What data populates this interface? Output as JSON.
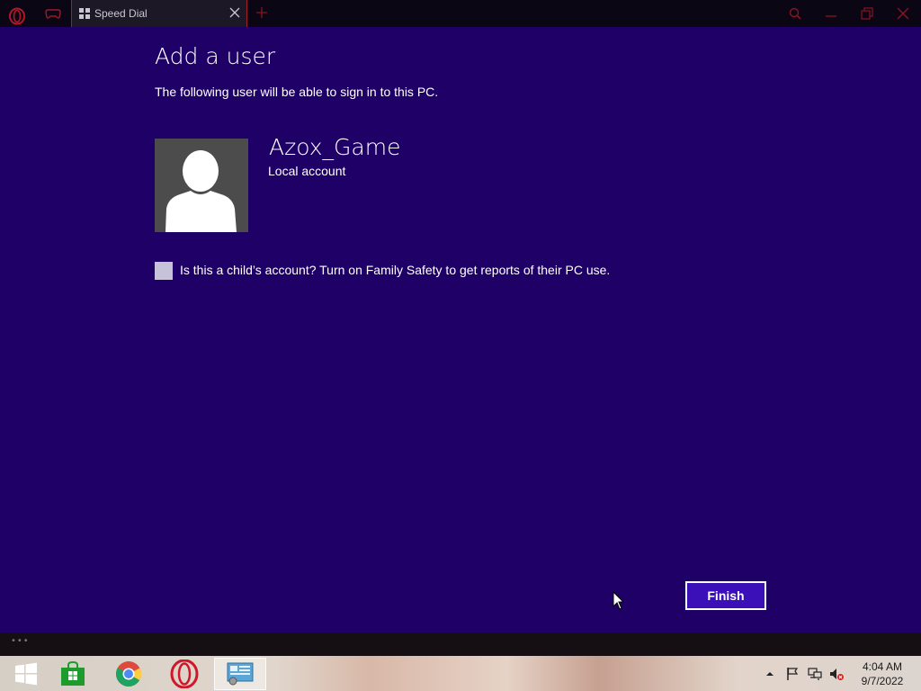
{
  "browser": {
    "tab_title": "Speed Dial",
    "icons": [
      "opera-logo-icon",
      "game-controller-icon",
      "speed-dial-grid-icon",
      "close-icon",
      "plus-icon",
      "search-icon",
      "minimize-icon",
      "restore-icon",
      "close-icon"
    ],
    "accent": "#a01d2a"
  },
  "dialog": {
    "title": "Add a user",
    "subtitle": "The following user will be able to sign in to this PC.",
    "user": {
      "name": "Azox_Game",
      "account_type": "Local account"
    },
    "child_checkbox": {
      "label": "Is this a child’s account? Turn on Family Safety to get reports of their PC use.",
      "checked": false
    },
    "finish_button": "Finish",
    "background": "#1e0066"
  },
  "taskbar": {
    "apps": [
      "windows-start-icon",
      "store-icon",
      "chrome-icon",
      "opera-icon",
      "control-panel-icon"
    ],
    "tray": [
      "show-hidden-icons-icon",
      "action-center-flag-icon",
      "network-icon",
      "volume-muted-icon"
    ],
    "clock": {
      "time": "4:04 AM",
      "date": "9/7/2022"
    }
  }
}
